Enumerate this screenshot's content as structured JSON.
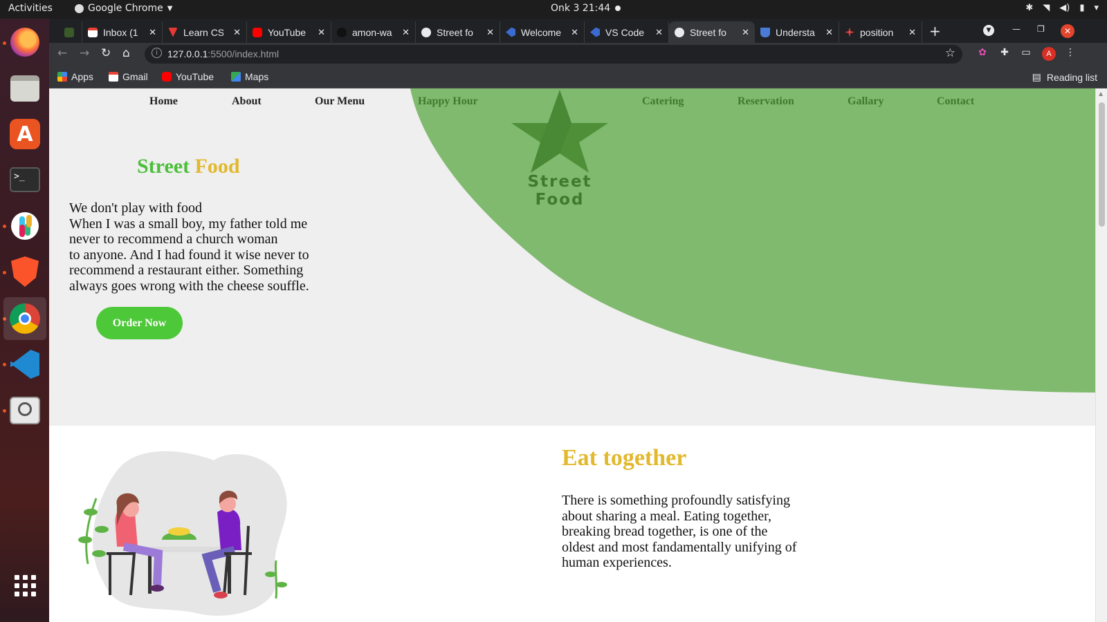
{
  "os": {
    "activities": "Activities",
    "app_name": "Google Chrome",
    "clock": "Onk 3  21:44"
  },
  "browser": {
    "tabs": [
      {
        "title": "",
        "icon": "tree-icon"
      },
      {
        "title": "Inbox (1",
        "icon": "gmail-icon"
      },
      {
        "title": "Learn CS",
        "icon": "learn-icon"
      },
      {
        "title": "YouTube",
        "icon": "youtube-icon"
      },
      {
        "title": "amon-wa",
        "icon": "github-icon"
      },
      {
        "title": "Street fo",
        "icon": "globe-icon"
      },
      {
        "title": "Welcome",
        "icon": "vscode-icon"
      },
      {
        "title": "VS Code",
        "icon": "vscode-icon"
      },
      {
        "title": "Street fo",
        "icon": "globe-icon"
      },
      {
        "title": "Understa",
        "icon": "bookmark-icon"
      },
      {
        "title": "position",
        "icon": "asterisk-icon"
      }
    ],
    "active_tab_index": 8,
    "url_host": "127.0.0.1",
    "url_path": ":5500/index.html",
    "bookmarks": [
      "Apps",
      "Gmail",
      "YouTube",
      "Maps"
    ],
    "reading_list": "Reading list",
    "avatar_letter": "A"
  },
  "page": {
    "nav": [
      "Home",
      "About",
      "Our Menu",
      "Happy Hour",
      "Catering",
      "Reservation",
      "Gallary",
      "Contact"
    ],
    "logo_text": "Street Food",
    "hero_title_part1": "Street",
    "hero_title_part2": "Food",
    "hero_lines": [
      "We don't play with food",
      "When I was a small boy, my father told me",
      "never to recommend a church woman",
      "to anyone. And I had found it wise never to",
      "recommend a restaurant either. Something",
      "always goes wrong with the cheese souffle."
    ],
    "order_button": "Order Now",
    "section_title": "Eat together",
    "section_lines": [
      "There is something profoundly satisfying",
      "about sharing a meal. Eating together,",
      "breaking bread together, is one of the",
      "oldest and most fandamentally unifying of",
      "human experiences."
    ]
  },
  "colors": {
    "green_shape": "#7fba6e",
    "green_dark": "#3f7a2e",
    "green_button": "#4dc838",
    "gold": "#e2b82c",
    "accent_green": "#4bbf3a"
  }
}
